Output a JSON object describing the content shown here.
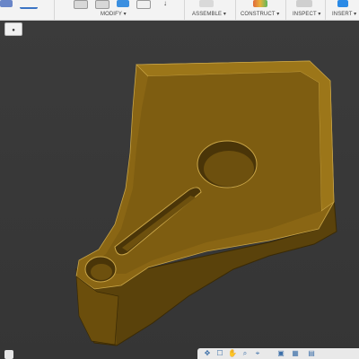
{
  "toolbar": {
    "groups": [
      {
        "label": "MODIFY ▾"
      },
      {
        "label": "ASSEMBLE ▾"
      },
      {
        "label": "CONSTRUCT ▾"
      },
      {
        "label": "INSPECT ▾"
      },
      {
        "label": "INSERT ▾"
      }
    ]
  },
  "browser": {
    "toggle_icon": "●"
  },
  "navbar": {
    "icons": [
      "✥",
      "☐",
      "✋",
      "⌕",
      "⌖",
      "▣",
      "▦",
      "▤"
    ]
  },
  "colors": {
    "part_face": "#7a5a10",
    "part_top": "#8f6b16",
    "part_side": "#5a420b",
    "part_edge": "#c9a547",
    "background": "#3a3a3a"
  }
}
